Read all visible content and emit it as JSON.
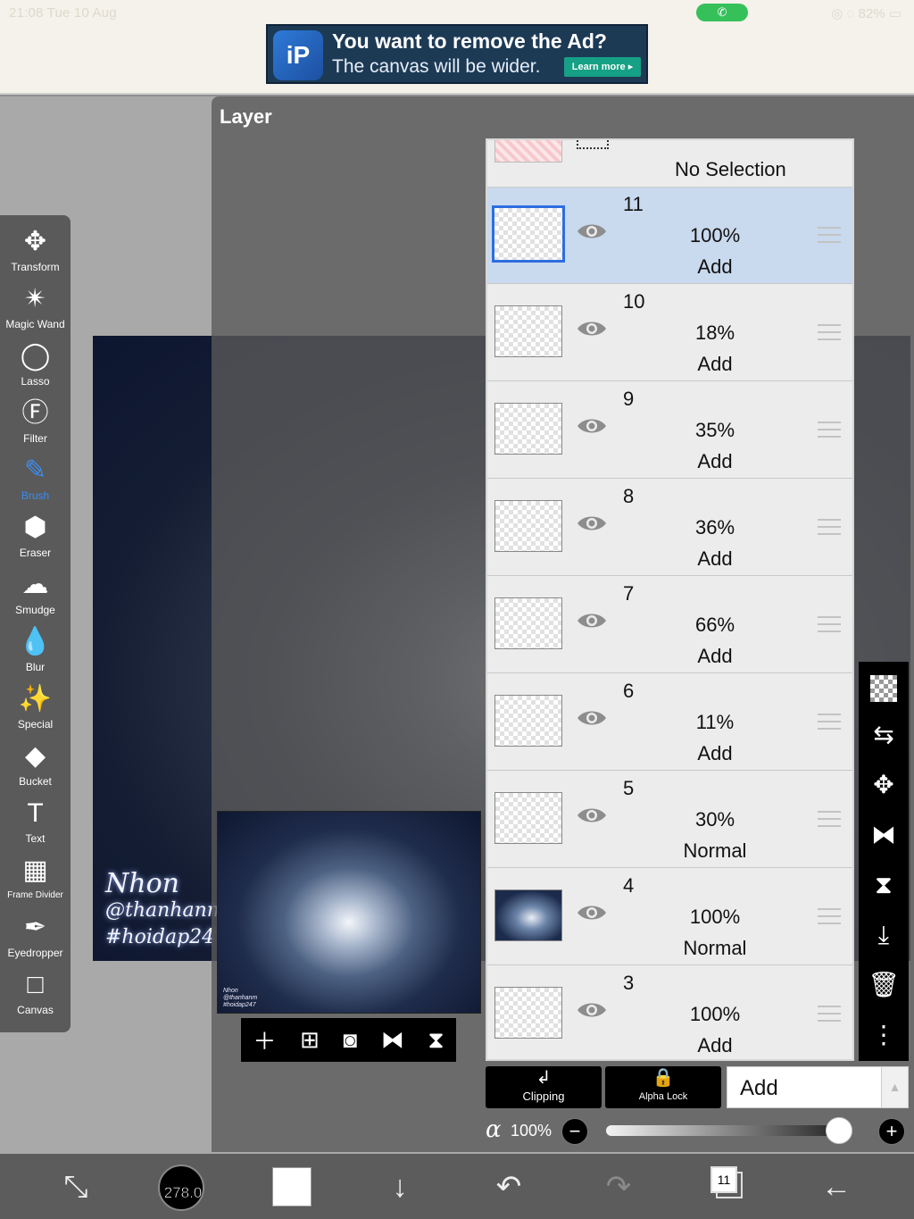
{
  "status_bar": {
    "time": "21:08",
    "date": "Tue 10 Aug",
    "battery": "82%"
  },
  "ad": {
    "title": "You want to remove the Ad?",
    "subtitle": "The canvas will be wider.",
    "button": "Learn more"
  },
  "panel": {
    "title": "Layer"
  },
  "artwork": {
    "signature_line1": "Nhon",
    "signature_line2": "@thanhanm",
    "signature_line3": "#hoidap247"
  },
  "tools": [
    {
      "label": "Transform",
      "icon": "transform-icon"
    },
    {
      "label": "Magic Wand",
      "icon": "magic-wand-icon"
    },
    {
      "label": "Lasso",
      "icon": "lasso-icon"
    },
    {
      "label": "Filter",
      "icon": "filter-icon"
    },
    {
      "label": "Brush",
      "icon": "brush-icon"
    },
    {
      "label": "Eraser",
      "icon": "eraser-icon"
    },
    {
      "label": "Smudge",
      "icon": "smudge-icon"
    },
    {
      "label": "Blur",
      "icon": "blur-icon"
    },
    {
      "label": "Special",
      "icon": "special-icon"
    },
    {
      "label": "Bucket",
      "icon": "bucket-icon"
    },
    {
      "label": "Text",
      "icon": "text-icon"
    },
    {
      "label": "Frame Divider",
      "icon": "frame-divider-icon"
    },
    {
      "label": "Eyedropper",
      "icon": "eyedropper-icon"
    },
    {
      "label": "Canvas",
      "icon": "canvas-icon"
    }
  ],
  "active_tool": "Brush",
  "no_selection_label": "No Selection",
  "layers": [
    {
      "number": "11",
      "opacity": "100%",
      "mode": "Add",
      "selected": true
    },
    {
      "number": "10",
      "opacity": "18%",
      "mode": "Add"
    },
    {
      "number": "9",
      "opacity": "35%",
      "mode": "Add"
    },
    {
      "number": "8",
      "opacity": "36%",
      "mode": "Add"
    },
    {
      "number": "7",
      "opacity": "66%",
      "mode": "Add"
    },
    {
      "number": "6",
      "opacity": "11%",
      "mode": "Add"
    },
    {
      "number": "5",
      "opacity": "30%",
      "mode": "Normal"
    },
    {
      "number": "4",
      "opacity": "100%",
      "mode": "Normal",
      "has_image": true
    },
    {
      "number": "3",
      "opacity": "100%",
      "mode": "Add"
    }
  ],
  "blend": {
    "clipping_label": "Clipping",
    "alpha_lock_label": "Alpha Lock",
    "mode_value": "Add",
    "alpha_symbol": "α",
    "opacity_label": "100%",
    "opacity_fraction": 1.0
  },
  "bottom": {
    "brush_size": "278.0",
    "layer_count": "11",
    "primary_color": "#ffffff"
  },
  "colors": {
    "accent": "#3b8cf0",
    "selected_row": "#c9d9ee",
    "toolbar": "#5a5a5a"
  }
}
